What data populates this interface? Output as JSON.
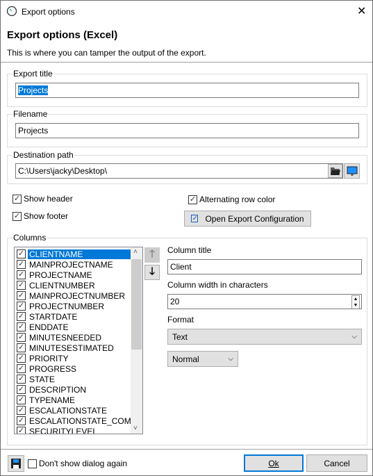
{
  "window": {
    "title": "Export options",
    "close_icon": "close-icon",
    "app_icon": "clock-icon"
  },
  "header": {
    "title": "Export options (Excel)",
    "subtitle": "This is where you can tamper the output of the export."
  },
  "export_title": {
    "label": "Export title",
    "value": "Projects"
  },
  "filename": {
    "label": "Filename",
    "value": "Projects"
  },
  "destination": {
    "label": "Destination path",
    "value": "C:\\Users\\jacky\\Desktop\\",
    "browse_icon": "folder-open-icon",
    "desktop_icon": "monitor-icon"
  },
  "options": {
    "show_header": {
      "label": "Show header",
      "checked": true
    },
    "show_footer": {
      "label": "Show footer",
      "checked": true
    },
    "alternating": {
      "label": "Alternating row color",
      "checked": true
    },
    "open_config_label": "Open Export Configuration"
  },
  "columns": {
    "label": "Columns",
    "selected": "CLIENTNAME",
    "items": [
      "CLIENTNAME",
      "MAINPROJECTNAME",
      "PROJECTNAME",
      "CLIENTNUMBER",
      "MAINPROJECTNUMBER",
      "PROJECTNUMBER",
      "STARTDATE",
      "ENDDATE",
      "MINUTESNEEDED",
      "MINUTESESTIMATED",
      "PRIORITY",
      "PROGRESS",
      "STATE",
      "DESCRIPTION",
      "TYPENAME",
      "ESCALATIONSTATE",
      "ESCALATIONSTATE_COMME",
      "SECURITYLEVEL"
    ]
  },
  "column_detail": {
    "title_label": "Column title",
    "title_value": "Client",
    "width_label": "Column width in characters",
    "width_value": "20",
    "format_label": "Format",
    "format_value": "Text",
    "style_value": "Normal"
  },
  "footer": {
    "dont_show_label": "Don't show dialog again",
    "dont_show_checked": false,
    "ok_label": "Ok",
    "cancel_label": "Cancel",
    "save_icon": "save-icon"
  }
}
